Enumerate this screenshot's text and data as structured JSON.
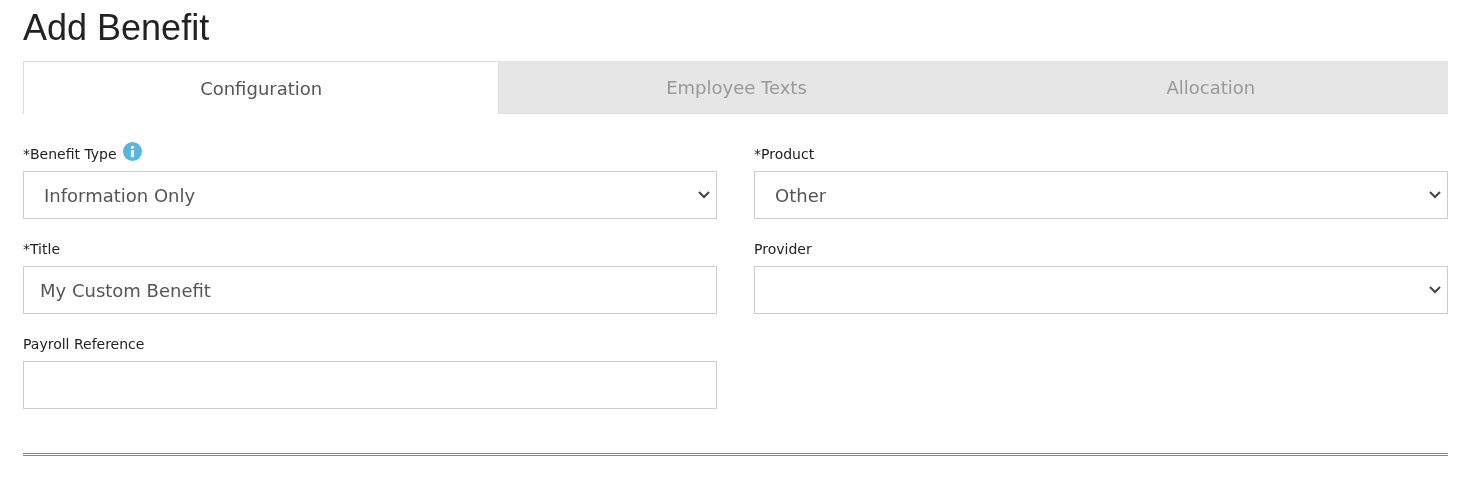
{
  "heading": "Add Benefit",
  "tabs": [
    {
      "label": "Configuration",
      "selected": true
    },
    {
      "label": "Employee Texts",
      "selected": false
    },
    {
      "label": "Allocation",
      "selected": false
    }
  ],
  "fields": [
    {
      "label": "*Benefit Type",
      "kind": "select",
      "value": "Information Only",
      "info": true
    },
    {
      "label": "*Product",
      "kind": "select",
      "value": "Other",
      "info": false
    },
    {
      "label": "*Title",
      "kind": "text",
      "value": "My Custom Benefit",
      "info": false
    },
    {
      "label": "Provider",
      "kind": "select",
      "info": false
    },
    {
      "label": "Payroll Reference",
      "kind": "text",
      "info": false
    }
  ]
}
